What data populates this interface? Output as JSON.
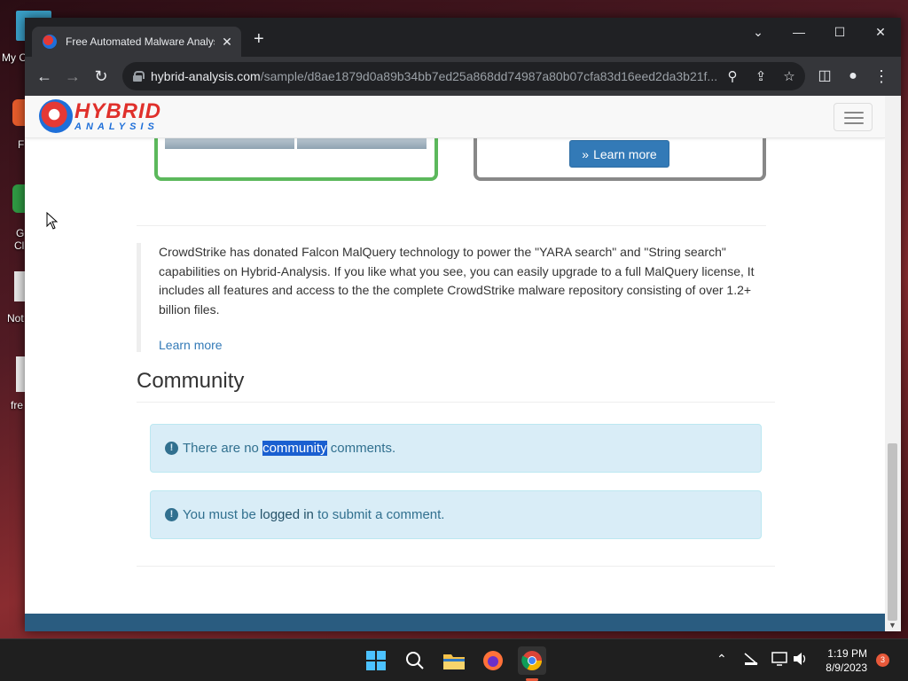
{
  "desktop": {
    "icons": [
      {
        "label": "My C"
      },
      {
        "label": "F"
      },
      {
        "label": "G"
      },
      {
        "label": "Cl"
      },
      {
        "label": "Not"
      },
      {
        "label": "fre"
      }
    ]
  },
  "browser": {
    "tab": {
      "title": "Free Automated Malware Analysis",
      "close": "✕"
    },
    "new_tab": "+",
    "window_controls": {
      "dropdown": "⌄",
      "minimize": "—",
      "maximize": "☐",
      "close": "✕"
    },
    "url_host": "hybrid-analysis.com",
    "url_path": "/sample/d8ae1879d0a89b34bb7ed25a868dd74987a80b07cfa83d16eed2da3b21f..."
  },
  "page": {
    "logo": {
      "line1": "HYBRID",
      "line2": "ANALYSIS"
    },
    "learn_more_button": "Learn more",
    "learn_more_icon": "»",
    "malquery_text": "CrowdStrike has donated Falcon MalQuery technology to power the \"YARA search\" and \"String search\" capabilities on Hybrid-Analysis. If you like what you see, you can easily upgrade to a full MalQuery license, It includes all features and access to the the complete CrowdStrike malware repository consisting of over 1.2+ billion files.",
    "malquery_link": "Learn more",
    "community_heading": "Community",
    "alert1": {
      "before": "There are no ",
      "highlight": "community",
      "after": " comments."
    },
    "alert2": {
      "before": "You must be ",
      "link": "logged in",
      "after": " to submit a comment."
    }
  },
  "taskbar": {
    "time": "1:19 PM",
    "date": "8/9/2023",
    "notification_count": "3"
  },
  "colors": {
    "accent_blue": "#337ab7",
    "alert_bg": "#d9edf7",
    "green_border": "#5cb85c",
    "highlight": "#1a5fd0"
  }
}
